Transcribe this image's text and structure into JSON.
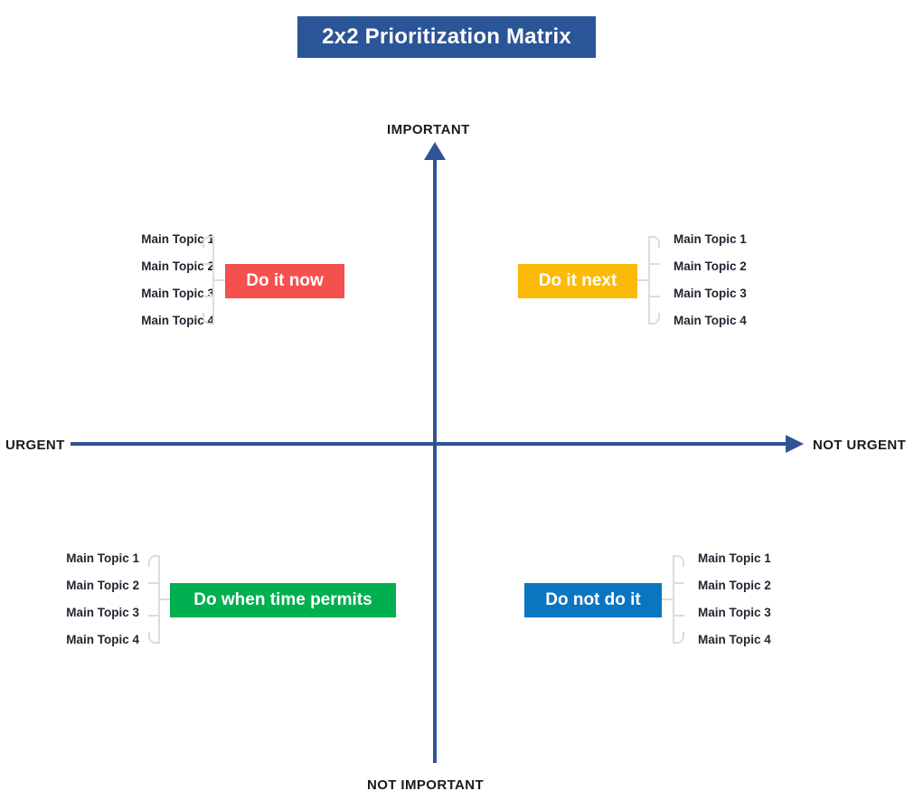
{
  "title": {
    "text": "2x2 Prioritization Matrix",
    "background_color": "#2A5596",
    "text_color": "#FFFFFF"
  },
  "axes": {
    "color": "#2E5496",
    "vertical_top_label": "IMPORTANT",
    "vertical_bottom_label": "NOT IMPORTANT",
    "horizontal_left_label": "URGENT",
    "horizontal_right_label": "NOT URGENT"
  },
  "quadrants": [
    {
      "id": "do-it-now",
      "position": "top-left",
      "action_label": "Do it now",
      "color": "#F4504E",
      "topics": [
        "Main Topic 1",
        "Main Topic 2",
        "Main Topic 3",
        "Main Topic 4"
      ]
    },
    {
      "id": "do-it-next",
      "position": "top-right",
      "action_label": "Do it next",
      "color": "#FBBA07",
      "topics": [
        "Main Topic 1",
        "Main Topic 2",
        "Main Topic 3",
        "Main Topic 4"
      ]
    },
    {
      "id": "do-when-time-permits",
      "position": "bottom-left",
      "action_label": "Do when time permits",
      "color": "#00AF50",
      "topics": [
        "Main Topic 1",
        "Main Topic 2",
        "Main Topic 3",
        "Main Topic 4"
      ]
    },
    {
      "id": "do-not-do-it",
      "position": "bottom-right",
      "action_label": "Do not do it",
      "color": "#0B76C0",
      "topics": [
        "Main Topic 1",
        "Main Topic 2",
        "Main Topic 3",
        "Main Topic 4"
      ]
    }
  ]
}
